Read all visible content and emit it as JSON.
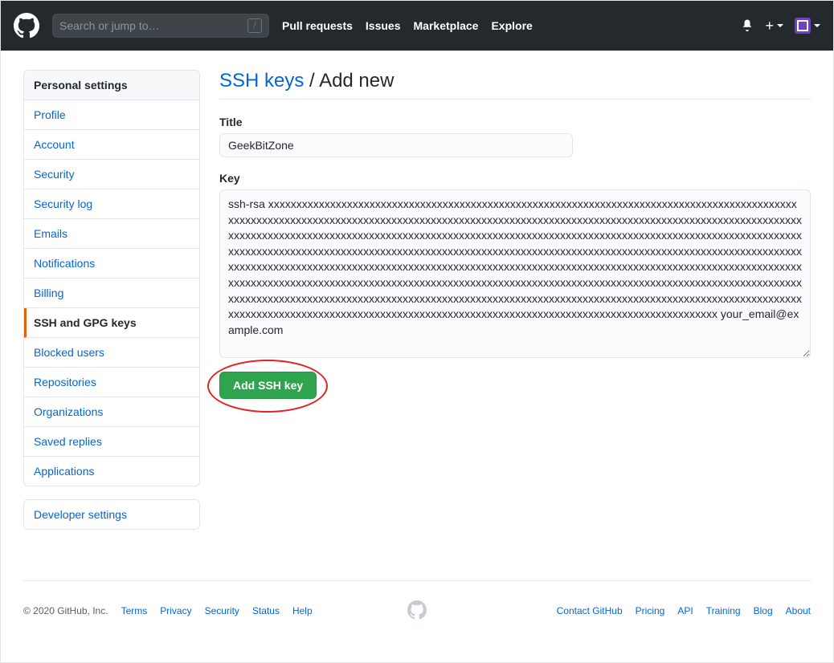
{
  "header": {
    "search_placeholder": "Search or jump to…",
    "slash_hint": "/",
    "nav": {
      "pull_requests": "Pull requests",
      "issues": "Issues",
      "marketplace": "Marketplace",
      "explore": "Explore"
    },
    "plus_symbol": "+"
  },
  "sidebar": {
    "title": "Personal settings",
    "items": {
      "profile": "Profile",
      "account": "Account",
      "security": "Security",
      "security_log": "Security log",
      "emails": "Emails",
      "notifications": "Notifications",
      "billing": "Billing",
      "ssh_gpg": "SSH and GPG keys",
      "blocked": "Blocked users",
      "repos": "Repositories",
      "orgs": "Organizations",
      "saved": "Saved replies",
      "apps": "Applications"
    },
    "developer": "Developer settings"
  },
  "main": {
    "breadcrumb_link": "SSH keys",
    "breadcrumb_sep": " / ",
    "breadcrumb_current": "Add new",
    "title_label": "Title",
    "title_value": "GeekBitZone",
    "key_label": "Key",
    "key_value": "ssh-rsa xxxxxxxxxxxxxxxxxxxxxxxxxxxxxxxxxxxxxxxxxxxxxxxxxxxxxxxxxxxxxxxxxxxxxxxxxxxxxxxxxxxxxxxxxxxxxxxxxxxxxxxxxxxxxxxxxxxxxxxxxxxxxxxxxxxxxxxxxxxxxxxxxxxxxxxxxxxxxxxxxxxxxxxxxxxxxxxxxxxxxxxxxxxxxxxxxxxxxxxxxxxxxxxxxxxxxxxxxxxxxxxxxxxxxxxxxxxxxxxxxxxxxxxxxxxxxxxxxxxxxxxxxxxxxxxxxxxxxxxxxxxxxxxxxxxxxxxxxxxxxxxxxxxxxxxxxxxxxxxxxxxxxxxxxxxxxxxxxxxxxxxxxxxxxxxxxxxxxxxxxxxxxxxxxxxxxxxxxxxxxxxxxxxxxxxxxxxxxxxxxxxxxxxxxxxxxxxxxxxxxxxxxxxxxxxxxxxxxxxxxxxxxxxxxxxxxxxxxxxxxxxxxxxxxxxxxxxxxxxxxxxxxxxxxxxxxxxxxxxxxxxxxxxxxxxxxxxxxxxxxxxxxxxxxxxxxxxxxxxxxxxxxxxxxxxxxxxxxxxxxxxxxxxxxxxxxxxxxxxxxxxxxxxxxxxxxxxxxxxxxxxxxxxxxxxxxxxxxxxxxxxxxxxxxxxxxxxxxxxxxxxxxxxxxxxxxxxxxxxxxxxxxxxxxxxxxxxxxxxxxxxxxxxxxxxxxxxxxxxxxxxxxxxxxxxxxxxxxxxxxxxxxxxxxxxxxxxxxxxxxxxxxxxxxxxxxxxxxxxxxxxxxxxxxxxxxxxxxxxxxxxxxxxxxxxxx your_email@example.com",
    "submit_label": "Add SSH key"
  },
  "footer": {
    "copyright": "© 2020 GitHub, Inc.",
    "left": {
      "terms": "Terms",
      "privacy": "Privacy",
      "security": "Security",
      "status": "Status",
      "help": "Help"
    },
    "right": {
      "contact": "Contact GitHub",
      "pricing": "Pricing",
      "api": "API",
      "training": "Training",
      "blog": "Blog",
      "about": "About"
    }
  }
}
